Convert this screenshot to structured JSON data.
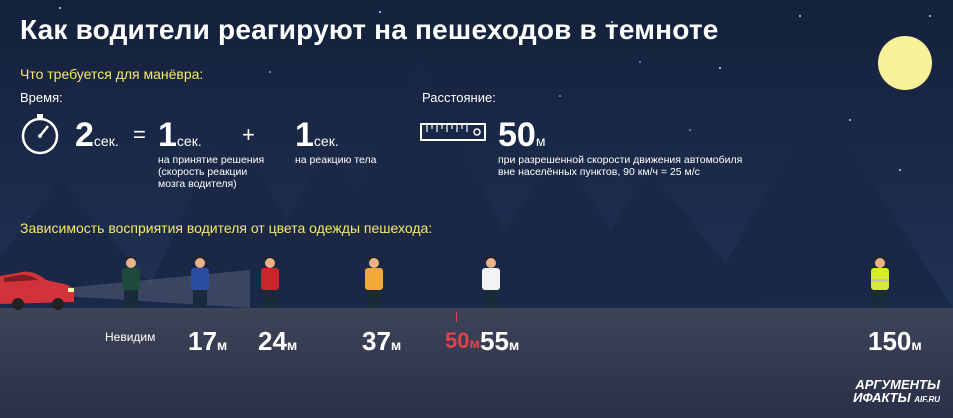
{
  "title": "Как водители реагируют на пешеходов в темноте",
  "subtitle": "Что требуется для манёвра:",
  "time": {
    "label": "Время:",
    "total_value": "2",
    "total_unit": "сек.",
    "equals": "=",
    "part1_value": "1",
    "part1_unit": "сек.",
    "part1_desc": "на принятие решения\n(скорость реакции\nмозга водителя)",
    "plus": "+",
    "part2_value": "1",
    "part2_unit": "сек.",
    "part2_desc": "на реакцию тела"
  },
  "distance": {
    "label": "Расстояние:",
    "value": "50",
    "unit": "м",
    "desc": "при разрешенной скорости движения автомобиля\nвне населённых пунктов, 90 км/ч = 25 м/с"
  },
  "clothing_heading": "Зависимость восприятия водителя от цвета одежды пешехода:",
  "pedestrians": [
    {
      "label": "Невидим",
      "value": "",
      "unit": "",
      "shirt": "#1d4a3a"
    },
    {
      "label": "",
      "value": "17",
      "unit": "м",
      "shirt": "#2a4fa0"
    },
    {
      "label": "",
      "value": "24",
      "unit": "м",
      "shirt": "#c8262c"
    },
    {
      "label": "",
      "value": "37",
      "unit": "м",
      "shirt": "#f2a93a"
    },
    {
      "label": "",
      "value": "55",
      "unit": "м",
      "shirt": "#f3f3f3"
    },
    {
      "label": "",
      "value": "150",
      "unit": "м",
      "shirt": "#d8ea2a"
    }
  ],
  "threshold": {
    "value": "50",
    "unit": "м"
  },
  "logo": {
    "line1": "АРГУМЕНТЫ",
    "line2": "ИФАКТЫ",
    "site": "AIF.RU"
  },
  "colors": {
    "accent": "#f4e96a",
    "threshold": "#e2414a",
    "moon": "#f8f19a"
  }
}
